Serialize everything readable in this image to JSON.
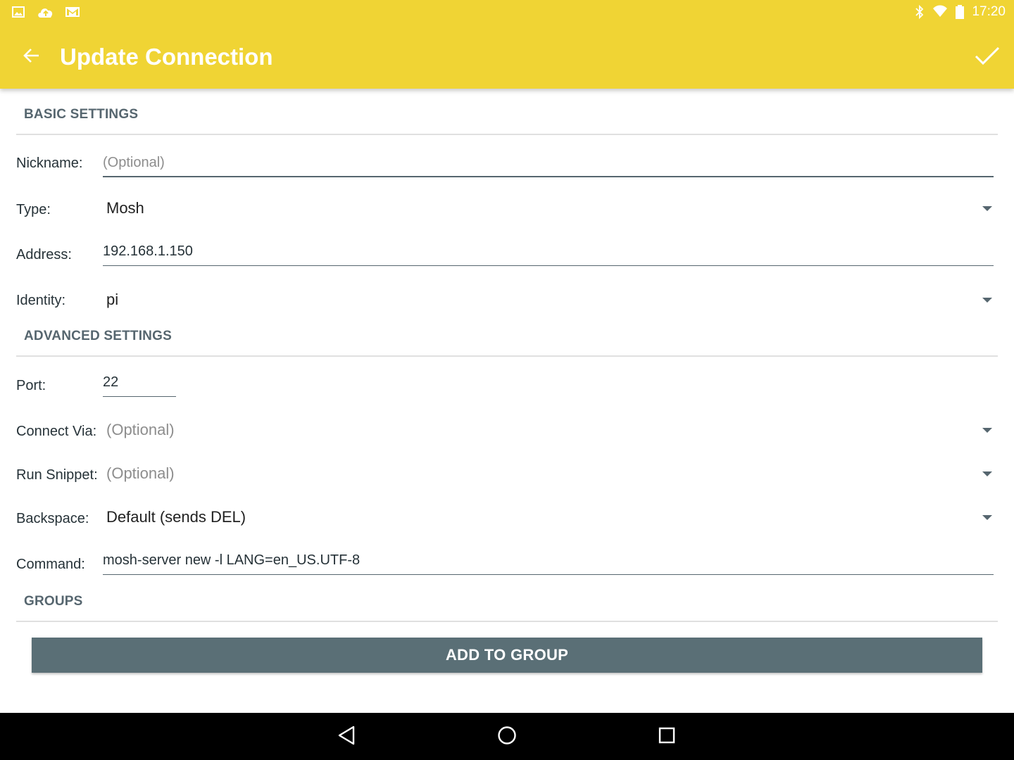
{
  "status_bar": {
    "time": "17:20",
    "left_icons": [
      "image-icon",
      "cloud-upload-icon",
      "gmail-icon"
    ],
    "right_icons": [
      "bluetooth-icon",
      "wifi-icon",
      "battery-icon"
    ]
  },
  "toolbar": {
    "title": "Update Connection",
    "back_icon": "arrow-back-icon",
    "confirm_icon": "check-icon",
    "color": "#f0d434"
  },
  "basic_settings": {
    "header": "BASIC SETTINGS",
    "nickname": {
      "label": "Nickname:",
      "value": "",
      "placeholder": "(Optional)"
    },
    "type": {
      "label": "Type:",
      "value": "Mosh"
    },
    "address": {
      "label": "Address:",
      "value": "192.168.1.150"
    },
    "identity": {
      "label": "Identity:",
      "value": "pi"
    }
  },
  "advanced_settings": {
    "header": "ADVANCED SETTINGS",
    "port": {
      "label": "Port:",
      "value": "22"
    },
    "connect_via": {
      "label": "Connect Via:",
      "value": "(Optional)"
    },
    "run_snippet": {
      "label": "Run Snippet:",
      "value": "(Optional)"
    },
    "backspace": {
      "label": "Backspace:",
      "value": "Default (sends DEL)"
    },
    "command": {
      "label": "Command:",
      "value": "mosh-server new -l LANG=en_US.UTF-8"
    }
  },
  "groups": {
    "header": "GROUPS",
    "add_button": "ADD TO GROUP",
    "button_color": "#5a6f76"
  },
  "nav_bar": {
    "icons": [
      "back-triangle-icon",
      "home-circle-icon",
      "recents-square-icon"
    ]
  }
}
